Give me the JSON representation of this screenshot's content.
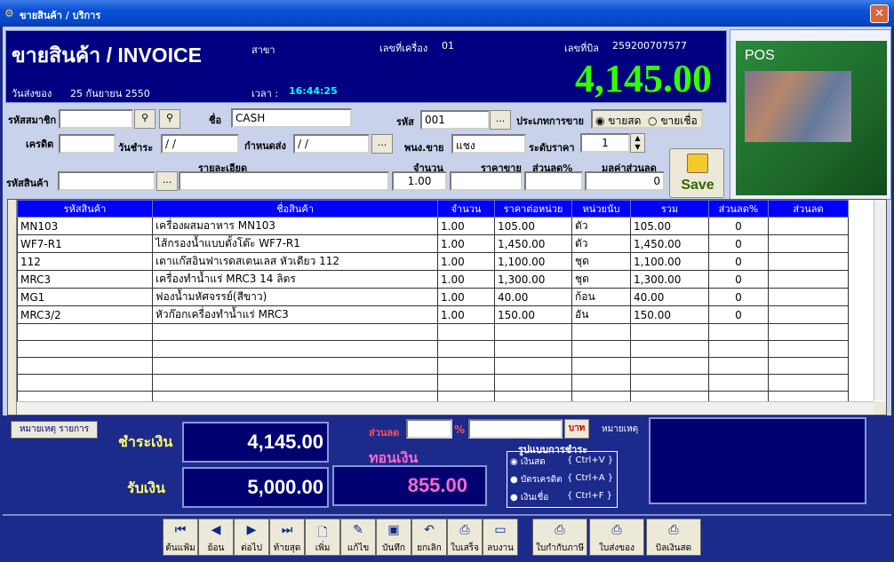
{
  "window": {
    "title": "ขายสินค้า / บริการ",
    "close": "✕"
  },
  "header": {
    "heading": "ขายสินค้า / INVOICE",
    "branch_label": "สาขา",
    "machine_label": "เลขที่เครื่อง",
    "machine_value": "01",
    "bill_label": "เลขที่บิล",
    "bill_value": "259200707577",
    "date_label": "วันส่งของ",
    "date_value": "25 กันยายน 2550",
    "time_label": "เวลา :",
    "time_value": "16:44:25",
    "total": "4,145.00"
  },
  "product_image": {
    "caption": "POS"
  },
  "form": {
    "member_code_label": "รหัสสมาชิก",
    "member_code_value": "",
    "name_label": "ชื่อ",
    "name_value": "CASH",
    "code_label": "รหัส",
    "code_value": "001",
    "sale_type_label": "ประเภทการขาย",
    "sale_type_options": [
      "ขายสด",
      "ขายเชื่อ"
    ],
    "sale_type_selected": "ขายสด",
    "credit_label": "เครดิต",
    "credit_value": "",
    "due_date_label": "วันชำระ",
    "due_date_value": " / /",
    "delivery_label": "กำหนดส่ง",
    "delivery_value": " / /",
    "salesperson_label": "พนง.ขาย",
    "salesperson_value": "แชง",
    "price_level_label": "ระดับราคา",
    "price_level_value": "1",
    "item_code_label": "รหัสสินค้า",
    "detail_label": "รายละเอียด",
    "qty_label": "จำนวน",
    "qty_value": "1.00",
    "sale_price_label": "ราคาขาย",
    "discount_pct_label": "ส่วนลด%",
    "discount_value_label": "มูลค่าส่วนลด",
    "discount_value": "0",
    "save_label": "Save",
    "ellipsis": "..."
  },
  "grid": {
    "columns": [
      "รหัสสินค้า",
      "ชื่อสินค้า",
      "จำนวน",
      "ราคาต่อหน่วย",
      "หน่วยนับ",
      "รวม",
      "ส่วนลด%",
      "ส่วนลด"
    ],
    "rows": [
      [
        "MN103",
        "เครื่องผสมอาหาร MN103",
        "1.00",
        "105.00",
        "ตัว",
        "105.00",
        "0",
        ""
      ],
      [
        "WF7-R1",
        "ไส้กรองน้ำแบบตั้งโต๊ะ WF7-R1",
        "1.00",
        "1,450.00",
        "ตัว",
        "1,450.00",
        "0",
        ""
      ],
      [
        "112",
        "เตาแก๊สอินฟาเรดสเตนเลส หัวเดียว 112",
        "1.00",
        "1,100.00",
        "ชุด",
        "1,100.00",
        "0",
        ""
      ],
      [
        "MRC3",
        "เครื่องทำน้ำแร่ MRC3 14 ลิตร",
        "1.00",
        "1,300.00",
        "ชุด",
        "1,300.00",
        "0",
        ""
      ],
      [
        "MG1",
        "ฟองน้ำมหัศจรรย์(สีขาว)",
        "1.00",
        "40.00",
        "ก้อน",
        "40.00",
        "0",
        ""
      ],
      [
        "MRC3/2",
        "หัวก๊อกเครื่องทำน้ำแร่ MRC3",
        "1.00",
        "150.00",
        "อัน",
        "150.00",
        "0",
        ""
      ],
      [
        "",
        "",
        "",
        "",
        "",
        "",
        "",
        ""
      ],
      [
        "",
        "",
        "",
        "",
        "",
        "",
        "",
        ""
      ],
      [
        "",
        "",
        "",
        "",
        "",
        "",
        "",
        ""
      ],
      [
        "",
        "",
        "",
        "",
        "",
        "",
        "",
        ""
      ],
      [
        "",
        "",
        "",
        "",
        "",
        "",
        "",
        ""
      ]
    ]
  },
  "summary": {
    "note_list_button": "หมายเหตุ รายการ",
    "pay_label": "ชำระเงิน",
    "pay_value": "4,145.00",
    "receive_label": "รับเงิน",
    "receive_value": "5,000.00",
    "discount_label": "ส่วนลด",
    "percent_sign": "%",
    "baht_label": "บาท",
    "change_label": "ทอนเงิน",
    "change_value": "855.00",
    "remark_label": "หมายเหตุ",
    "payment_title": "รูปแบบการชำระ",
    "payment_methods": [
      {
        "label": "เงินสด",
        "shortcut": "{ Ctrl+V }"
      },
      {
        "label": "บัตรเครดิต",
        "shortcut": "{ Ctrl+A }"
      },
      {
        "label": "เงินเชื่อ",
        "shortcut": "{ Ctrl+F }"
      }
    ]
  },
  "toolbar": {
    "first": "ต้นแฟ้ม",
    "prev": "ย้อน",
    "next": "ต่อไป",
    "last": "ท้ายสุด",
    "add": "เพิ่ม",
    "edit": "แก้ไข",
    "save": "บันทึก",
    "cancel": "ยกเลิก",
    "receipt": "ใบเสร็จ",
    "delete": "ลบงาน",
    "tax_invoice": "ใบกำกับภาษี",
    "delivery_note": "ใบส่งของ",
    "cash_bill": "บิลเงินสด"
  },
  "colors": {
    "total_green": "#33ff00",
    "change_pink": "#ff66cc",
    "grid_header": "#0000ff",
    "panel_navy": "#000070"
  }
}
